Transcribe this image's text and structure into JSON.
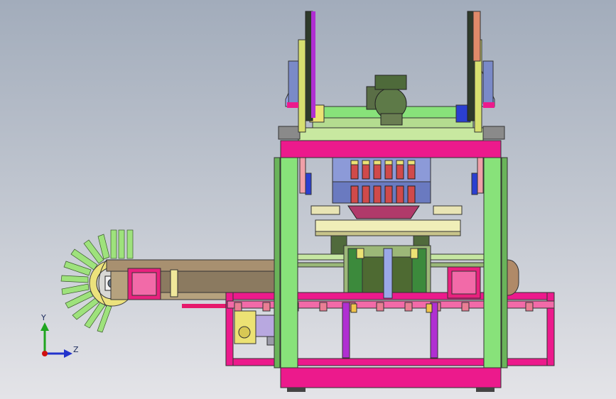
{
  "viewport": {
    "background_top": "#a2acbb",
    "background_bottom": "#e4e4e8"
  },
  "triad": {
    "y_label": "Y",
    "z_label": "Z",
    "y_color": "#1fa51f",
    "z_color": "#2233cc",
    "x_color": "#d01010"
  },
  "palette": {
    "magenta": "#ec1a8c",
    "green": "#88e27a",
    "dark_green": "#506a3c",
    "olive": "#7f8a58",
    "purple": "#b02fd2",
    "yellow": "#ece274",
    "blue": "#2b3fd0",
    "light_green": "#c6e6a2",
    "brown": "#b08a68"
  }
}
